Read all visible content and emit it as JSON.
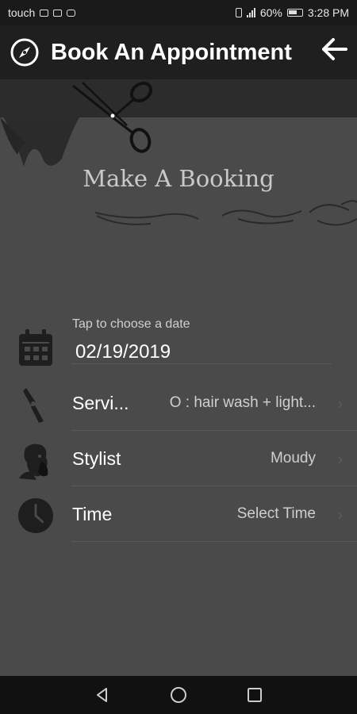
{
  "status_bar": {
    "carrier": "touch",
    "battery_percent": "60%",
    "time": "3:28 PM",
    "icons": [
      "email-icon",
      "calendar-icon",
      "instagram-icon",
      "vibrate-icon",
      "signal-icon",
      "battery-icon"
    ]
  },
  "app_bar": {
    "title": "Book An Appointment",
    "left_icon": "compass-icon",
    "right_icon": "back-arrow-icon"
  },
  "banner": {
    "title": "Make A Booking",
    "decoration": "scissors-and-hair"
  },
  "date": {
    "hint": "Tap to choose a date",
    "value": "02/19/2019",
    "icon": "calendar-icon"
  },
  "rows": [
    {
      "label": "Servi...",
      "value": "O : hair wash + light...",
      "icon": "razor-icon"
    },
    {
      "label": "Stylist",
      "value": "Moudy",
      "icon": "barber-icon"
    },
    {
      "label": "Time",
      "value": "Select Time",
      "icon": "clock-icon"
    }
  ],
  "nav": {
    "back": "back-triangle-icon",
    "home": "home-circle-icon",
    "recents": "recents-square-icon"
  },
  "colors": {
    "background": "#4a4a4a",
    "app_bar": "#1f1f1f",
    "status_bar": "#1a1a1a",
    "nav_bar": "#111111"
  }
}
